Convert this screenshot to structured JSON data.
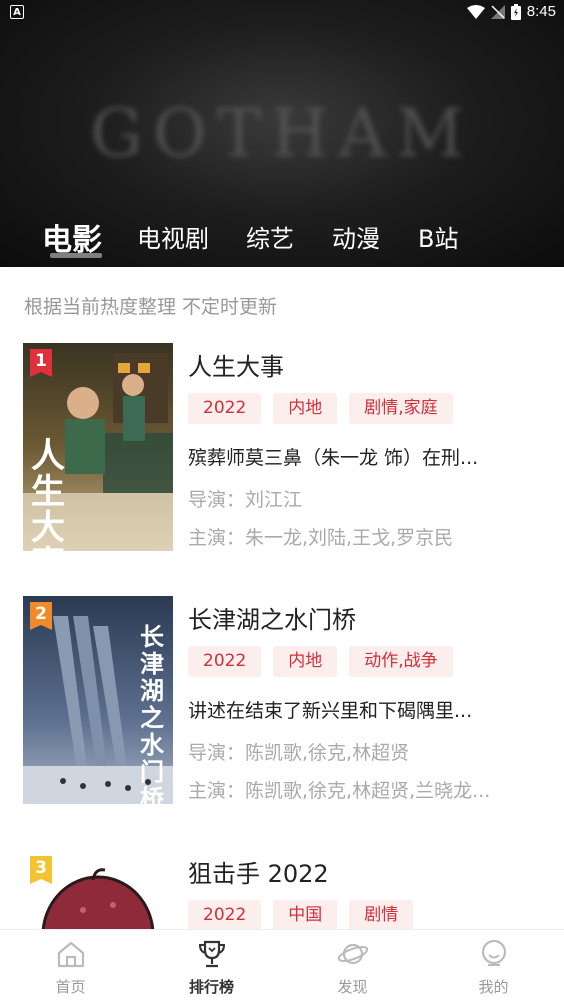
{
  "status_bar": {
    "time": "8:45",
    "app_indicator": "A"
  },
  "banner": {
    "backdrop_text": "GOTHAM"
  },
  "tabs": [
    {
      "label": "电影",
      "active": true
    },
    {
      "label": "电视剧",
      "active": false
    },
    {
      "label": "综艺",
      "active": false
    },
    {
      "label": "动漫",
      "active": false
    },
    {
      "label": "B站",
      "active": false
    }
  ],
  "subtitle": "根据当前热度整理 不定时更新",
  "items": [
    {
      "rank": "1",
      "rank_color": "#e0303a",
      "poster_text": "人生大事",
      "title": "人生大事",
      "tags": [
        "2022",
        "内地",
        "剧情,家庭"
      ],
      "description": "殡葬师莫三鼻（朱一龙 饰）在刑...",
      "director": "导演：刘江江",
      "cast": "主演：朱一龙,刘陆,王戈,罗京民"
    },
    {
      "rank": "2",
      "rank_color": "#f08a2a",
      "poster_text": "长津湖之水门桥",
      "title": "长津湖之水门桥",
      "tags": [
        "2022",
        "内地",
        "动作,战争"
      ],
      "description": "讲述在结束了新兴里和下碣隅里...",
      "director": "导演：陈凯歌,徐克,林超贤",
      "cast": "主演：陈凯歌,徐克,林超贤,兰晓龙..."
    },
    {
      "rank": "3",
      "rank_color": "#f4c430",
      "title": "狙击手 2022",
      "tags": [
        "2022",
        "中国",
        "剧情"
      ]
    }
  ],
  "bottom_nav": [
    {
      "label": "首页",
      "icon": "home-icon",
      "active": false
    },
    {
      "label": "排行榜",
      "icon": "trophy-icon",
      "active": true
    },
    {
      "label": "发现",
      "icon": "planet-icon",
      "active": false
    },
    {
      "label": "我的",
      "icon": "profile-icon",
      "active": false
    }
  ]
}
